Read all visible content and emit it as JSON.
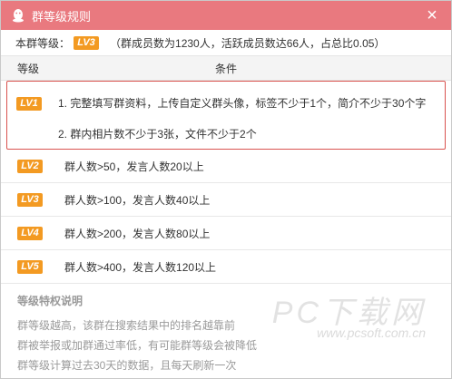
{
  "window": {
    "title": "群等级规则",
    "close_glyph": "×"
  },
  "summary": {
    "label": "本群等级：",
    "level_badge": "LV3",
    "stats": "（群成员数为1230人，活跃成员数达66人，占总比0.05）"
  },
  "table": {
    "headers": {
      "level": "等级",
      "condition": "条件"
    },
    "rows": [
      {
        "badge": "LV1",
        "lines": [
          "1. 完整填写群资料，上传自定义群头像，标签不少于1个，简介不少于30个字",
          "2. 群内相片数不少于3张，文件不少于2个"
        ]
      },
      {
        "badge": "LV2",
        "lines": [
          "群人数>50，发言人数20以上"
        ]
      },
      {
        "badge": "LV3",
        "lines": [
          "群人数>100，发言人数40以上"
        ]
      },
      {
        "badge": "LV4",
        "lines": [
          "群人数>200，发言人数80以上"
        ]
      },
      {
        "badge": "LV5",
        "lines": [
          "群人数>400，发言人数120以上"
        ]
      }
    ]
  },
  "notes": {
    "title": "等级特权说明",
    "lines": [
      "群等级越高，该群在搜索结果中的排名越靠前",
      "群被举报或加群通过率低，有可能群等级会被降低",
      "群等级计算过去30天的数据，且每天刷新一次"
    ]
  },
  "watermark": {
    "main": "PC下载网",
    "sub": "www.pcsoft.com.cn"
  },
  "colors": {
    "titlebar": "#e9797f",
    "badge": "#f39a22",
    "highlight_border": "#d9534f"
  }
}
